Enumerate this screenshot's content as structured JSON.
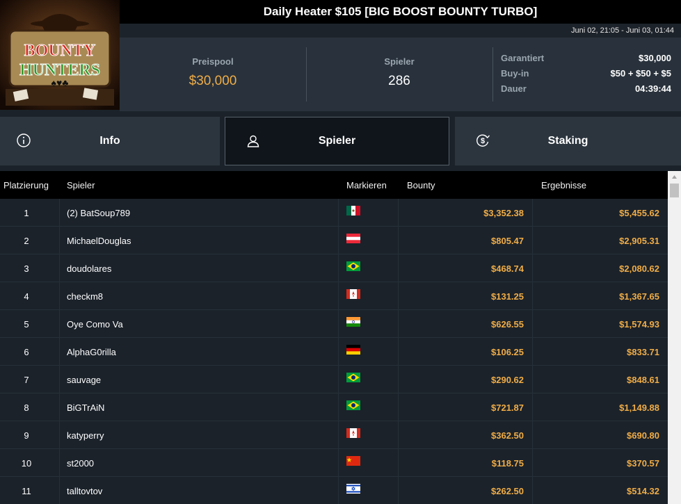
{
  "header": {
    "title": "Daily Heater $105 [BIG BOOST BOUNTY TURBO]",
    "date_range": "Juni 02, 21:05 - Juni 03, 01:44",
    "logo_line1": "BOUNTY",
    "logo_line2": "HUNTERS"
  },
  "stats": {
    "prizepool_label": "Preispool",
    "prizepool_value": "$30,000",
    "players_label": "Spieler",
    "players_value": "286",
    "guaranteed_label": "Garantiert",
    "guaranteed_value": "$30,000",
    "buyin_label": "Buy-in",
    "buyin_value": "$50 + $50 + $5",
    "duration_label": "Dauer",
    "duration_value": "04:39:44"
  },
  "tabs": [
    {
      "label": "Info",
      "icon": "info-icon",
      "active": false
    },
    {
      "label": "Spieler",
      "icon": "user-icon",
      "active": true
    },
    {
      "label": "Staking",
      "icon": "dollar-cycle-icon",
      "active": false
    }
  ],
  "table": {
    "headers": {
      "rank": "Platzierung",
      "player": "Spieler",
      "flag": "Markieren",
      "bounty": "Bounty",
      "results": "Ergebnisse"
    },
    "rows": [
      {
        "rank": "1",
        "player": "(2) BatSoup789",
        "flag": "mexico",
        "bounty": "$3,352.38",
        "result": "$5,455.62"
      },
      {
        "rank": "2",
        "player": "MichaelDouglas",
        "flag": "austria",
        "bounty": "$805.47",
        "result": "$2,905.31"
      },
      {
        "rank": "3",
        "player": "doudolares",
        "flag": "brazil",
        "bounty": "$468.74",
        "result": "$2,080.62"
      },
      {
        "rank": "4",
        "player": "checkm8",
        "flag": "canada",
        "bounty": "$131.25",
        "result": "$1,367.65"
      },
      {
        "rank": "5",
        "player": "Oye Como Va",
        "flag": "india",
        "bounty": "$626.55",
        "result": "$1,574.93"
      },
      {
        "rank": "6",
        "player": "AlphaG0rilla",
        "flag": "germany",
        "bounty": "$106.25",
        "result": "$833.71"
      },
      {
        "rank": "7",
        "player": "sauvage",
        "flag": "brazil",
        "bounty": "$290.62",
        "result": "$848.61"
      },
      {
        "rank": "8",
        "player": "BiGTrAiN",
        "flag": "brazil",
        "bounty": "$721.87",
        "result": "$1,149.88"
      },
      {
        "rank": "9",
        "player": "katyperry",
        "flag": "canada",
        "bounty": "$362.50",
        "result": "$690.80"
      },
      {
        "rank": "10",
        "player": "st2000",
        "flag": "china",
        "bounty": "$118.75",
        "result": "$370.57"
      },
      {
        "rank": "11",
        "player": "talltovtov",
        "flag": "israel",
        "bounty": "$262.50",
        "result": "$514.32"
      }
    ]
  },
  "colors": {
    "accent": "#f0ad47",
    "bg": "#1b222a",
    "panel": "#29323c",
    "tab": "#2c353e",
    "tab_active": "#10151b"
  }
}
